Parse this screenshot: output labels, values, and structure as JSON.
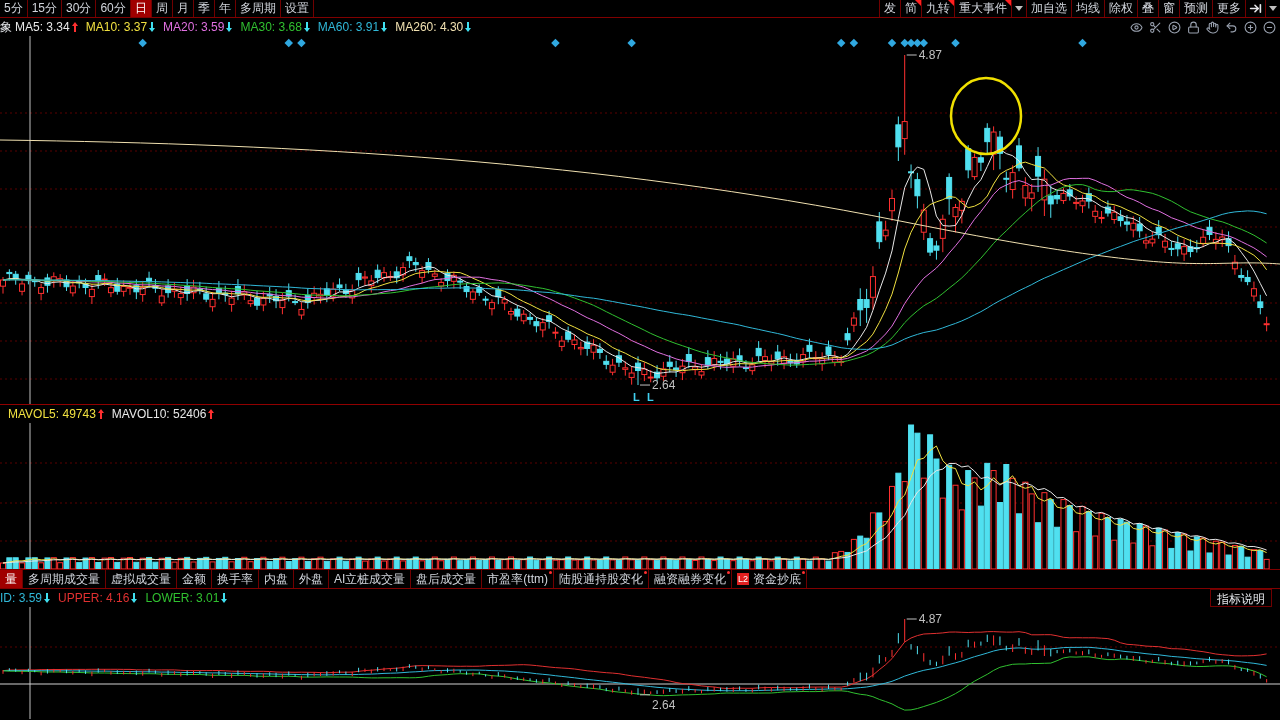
{
  "period_tabs": [
    {
      "label": "5分",
      "selected": false
    },
    {
      "label": "15分",
      "selected": false
    },
    {
      "label": "30分",
      "selected": false
    },
    {
      "label": "60分",
      "selected": false
    },
    {
      "label": "日",
      "selected": true
    },
    {
      "label": "周",
      "selected": false
    },
    {
      "label": "月",
      "selected": false
    },
    {
      "label": "季",
      "selected": false
    },
    {
      "label": "年",
      "selected": false
    },
    {
      "label": "多周期",
      "selected": false
    },
    {
      "label": "设置",
      "selected": false
    }
  ],
  "tool_buttons": [
    {
      "label": "发",
      "flag": false
    },
    {
      "label": "简",
      "flag": true
    },
    {
      "label": "九转",
      "flag": true
    },
    {
      "label": "重大事件",
      "flag": true
    }
  ],
  "tool_buttons_2": [
    "加自选",
    "均线",
    "除权",
    "叠",
    "窗",
    "预测",
    "更多"
  ],
  "ma_legend_prefix": "象",
  "ma_legend": [
    {
      "label": "MA5: 3.34",
      "rising": true,
      "color": "#e8e8e8"
    },
    {
      "label": "MA10: 3.37",
      "rising": false,
      "color": "#f0e040"
    },
    {
      "label": "MA20: 3.59",
      "rising": false,
      "color": "#e070e0"
    },
    {
      "label": "MA30: 3.68",
      "rising": false,
      "color": "#30c030"
    },
    {
      "label": "MA60: 3.91",
      "rising": false,
      "color": "#30b8d8"
    },
    {
      "label": "MA260: 4.30",
      "rising": false,
      "color": "#f0e0b0"
    }
  ],
  "price_annotations": [
    {
      "text": "4.87",
      "kind": "high"
    },
    {
      "text": "2.64",
      "kind": "low"
    }
  ],
  "bottom_marks": [
    "L",
    "L"
  ],
  "volume_legend": [
    {
      "label": "MAVOL5: 49743",
      "rising": true,
      "color": "#f0e040"
    },
    {
      "label": "MAVOL10: 52406",
      "rising": true,
      "color": "#e8e8e8"
    }
  ],
  "indicator_tabs": [
    {
      "label": "量",
      "selected": true,
      "dot": false
    },
    {
      "label": "多周期成交量",
      "selected": false,
      "dot": false
    },
    {
      "label": "虚拟成交量",
      "selected": false,
      "dot": false
    },
    {
      "label": "金额",
      "selected": false,
      "dot": false
    },
    {
      "label": "换手率",
      "selected": false,
      "dot": false
    },
    {
      "label": "内盘",
      "selected": false,
      "dot": false
    },
    {
      "label": "外盘",
      "selected": false,
      "dot": false
    },
    {
      "label": "AI立桩成交量",
      "selected": false,
      "dot": false
    },
    {
      "label": "盘后成交量",
      "selected": false,
      "dot": false
    },
    {
      "label": "市盈率(ttm)",
      "selected": false,
      "dot": true
    },
    {
      "label": "陆股通持股变化",
      "selected": false,
      "dot": true
    },
    {
      "label": "融资融券变化",
      "selected": false,
      "dot": true
    },
    {
      "label": "资金抄底",
      "selected": false,
      "dot": true,
      "badge": "L2"
    }
  ],
  "boll_legend": [
    {
      "label": "ID: 3.59",
      "rising": false,
      "color": "#30b8d8"
    },
    {
      "label": "UPPER: 4.16",
      "rising": false,
      "color": "#e03030"
    },
    {
      "label": "LOWER: 3.01",
      "rising": false,
      "color": "#30c030"
    }
  ],
  "help_button": "指标说明",
  "boll_annotations": [
    {
      "text": "4.87",
      "kind": "high"
    },
    {
      "text": "2.64",
      "kind": "low"
    }
  ]
}
